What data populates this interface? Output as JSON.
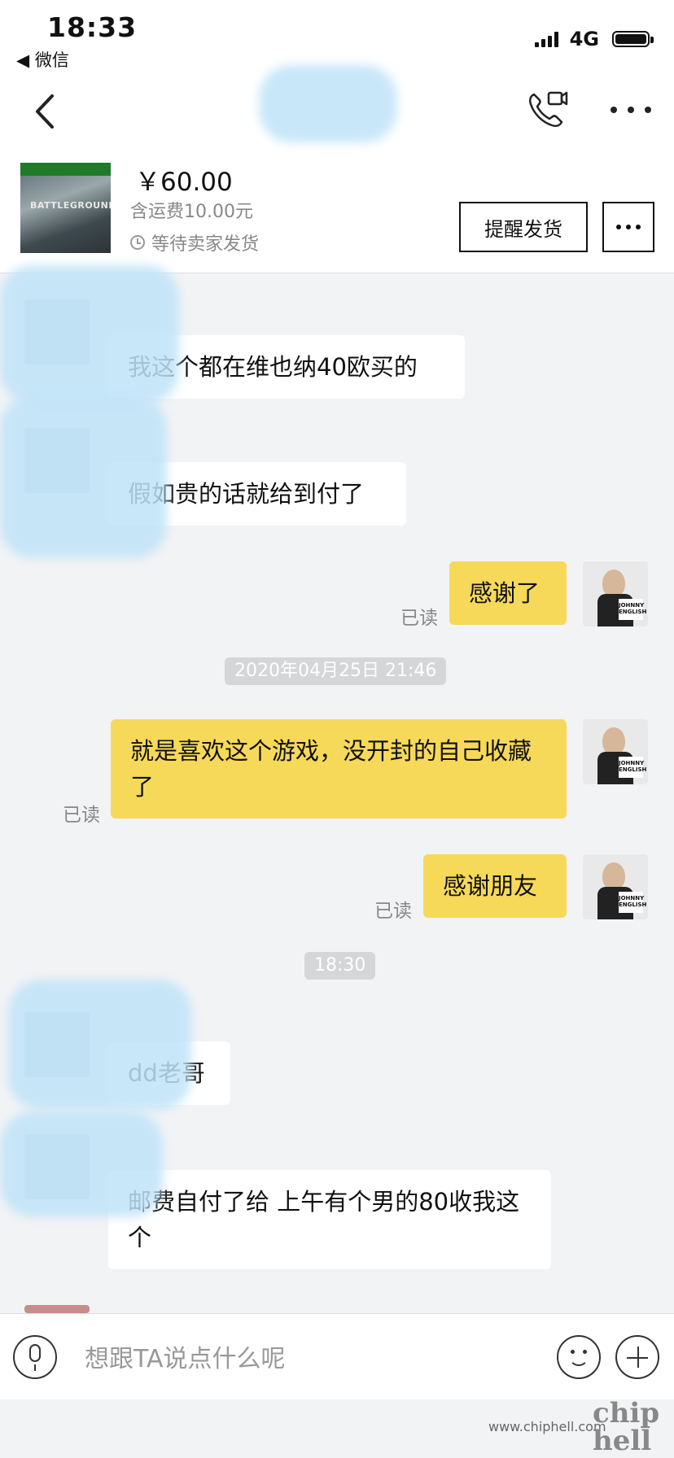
{
  "status_bar": {
    "time": "18:33",
    "back_app": "◀ 微信",
    "network": "4G"
  },
  "nav": {
    "title": ""
  },
  "product": {
    "price": "￥60.00",
    "shipping": "含运费10.00元",
    "status": "等待卖家发货",
    "remind_button": "提醒发货",
    "thumb_text": "BATTLEGROUNDS"
  },
  "messages": [
    {
      "side": "left",
      "text": "我这个都在维也纳40欧买的"
    },
    {
      "side": "left",
      "text": "假如贵的话就给到付了"
    },
    {
      "side": "right",
      "text": "感谢了",
      "read": "已读"
    },
    {
      "type": "time",
      "text": "2020年04月25日 21:46"
    },
    {
      "side": "right",
      "text": "就是喜欢这个游戏，没开封的自己收藏了",
      "read": "已读"
    },
    {
      "side": "right",
      "text": "感谢朋友",
      "read": "已读"
    },
    {
      "type": "time",
      "text": "18:30"
    },
    {
      "side": "left",
      "text": "dd老哥"
    },
    {
      "side": "left",
      "text": "邮费自付了给 上午有个男的80收我这个"
    }
  ],
  "input": {
    "placeholder": "想跟TA说点什么呢"
  },
  "watermark": {
    "url": "www.chiphell.com",
    "logo": "chip hell"
  },
  "colors": {
    "bubble_self": "#f7d95a",
    "bubble_other": "#ffffff",
    "background": "#f2f3f5"
  }
}
